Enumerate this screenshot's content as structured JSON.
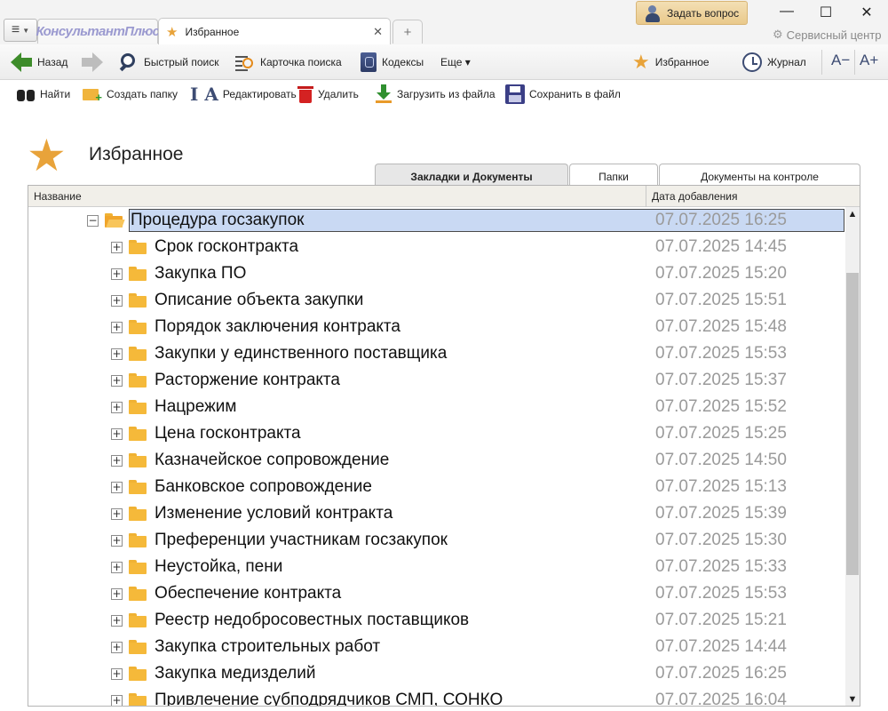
{
  "titlebar": {
    "logo_text": "КонсультантПлюс",
    "tab_title": "Избранное",
    "ask_button": "Задать вопрос",
    "service_center": "Сервисный центр",
    "minimize": "—",
    "maximize": "☐",
    "close": "✕",
    "tab_close": "✕",
    "new_tab": "+"
  },
  "toolbar": {
    "back": "Назад",
    "quick_search": "Быстрый поиск",
    "search_card": "Карточка поиска",
    "codexes": "Кодексы",
    "more": "Еще ▾",
    "favorites": "Избранное",
    "journal": "Журнал",
    "font_smaller": "A−",
    "font_larger": "A+"
  },
  "actions": {
    "find": "Найти",
    "create_folder": "Создать папку",
    "edit": "Редактировать",
    "delete": "Удалить",
    "load_from_file": "Загрузить из файла",
    "save_to_file": "Сохранить в файл"
  },
  "page": {
    "title": "Избранное"
  },
  "view_tabs": [
    {
      "label": "Закладки и Документы",
      "active": true
    },
    {
      "label": "Папки",
      "active": false
    },
    {
      "label": "Документы на контроле",
      "active": false
    }
  ],
  "table": {
    "columns": {
      "name": "Название",
      "date": "Дата добавления"
    },
    "root": {
      "name": "Процедура госзакупок",
      "date": "07.07.2025 16:25",
      "expander": "−"
    },
    "items": [
      {
        "name": "Срок госконтракта",
        "date": "07.07.2025 14:45"
      },
      {
        "name": "Закупка ПО",
        "date": "07.07.2025 15:20"
      },
      {
        "name": "Описание объекта закупки",
        "date": "07.07.2025 15:51"
      },
      {
        "name": "Порядок заключения контракта",
        "date": "07.07.2025 15:48"
      },
      {
        "name": "Закупки у единственного поставщика",
        "date": "07.07.2025 15:53"
      },
      {
        "name": "Расторжение контракта",
        "date": "07.07.2025 15:37"
      },
      {
        "name": "Нацрежим",
        "date": "07.07.2025 15:52"
      },
      {
        "name": "Цена госконтракта",
        "date": "07.07.2025 15:25"
      },
      {
        "name": "Казначейское сопровождение",
        "date": "07.07.2025 14:50"
      },
      {
        "name": "Банковское сопровождение",
        "date": "07.07.2025 15:13"
      },
      {
        "name": "Изменение условий контракта",
        "date": "07.07.2025 15:39"
      },
      {
        "name": "Преференции участникам госзакупок",
        "date": "07.07.2025 15:30"
      },
      {
        "name": "Неустойка, пени",
        "date": "07.07.2025 15:33"
      },
      {
        "name": "Обеспечение контракта",
        "date": "07.07.2025 15:53"
      },
      {
        "name": "Реестр недобросовестных поставщиков",
        "date": "07.07.2025 15:21"
      },
      {
        "name": "Закупка строительных работ",
        "date": "07.07.2025 14:44"
      },
      {
        "name": "Закупка медизделий",
        "date": "07.07.2025 16:25"
      },
      {
        "name": "Привлечение субподрядчиков СМП, СОНКО",
        "date": "07.07.2025 16:04"
      }
    ],
    "item_expander": "+"
  },
  "scrollbar": {
    "up": "▲",
    "down": "▼"
  },
  "colors": {
    "accent_star": "#e8a33a",
    "selection": "#c9d9f3",
    "date_text": "#9a9a9a",
    "ask_button": "#e9c98b"
  },
  "icons": {
    "menu": "menu-icon",
    "back": "arrow-left-icon",
    "forward": "arrow-right-icon",
    "quick_search": "magnifier-icon",
    "search_card": "search-card-icon",
    "codexes": "codex-book-icon",
    "favorites": "star-icon",
    "journal": "clock-icon",
    "find": "binoculars-icon",
    "create_folder": "folder-add-icon",
    "edit": "edit-text-icon",
    "delete": "trash-icon",
    "load": "download-icon",
    "save": "floppy-icon",
    "folder": "folder-icon"
  }
}
